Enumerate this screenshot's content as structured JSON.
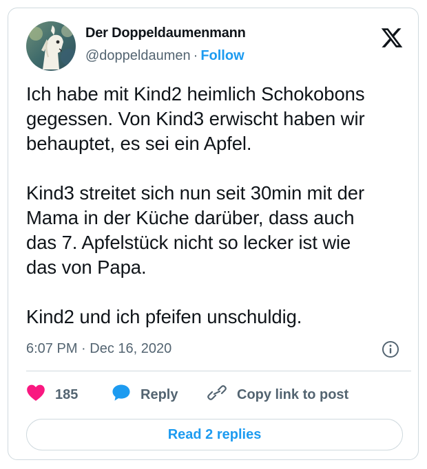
{
  "author": {
    "name": "Der Doppeldaumenmann",
    "handle": "@doppeldaumen",
    "separator": "·",
    "follow_label": "Follow",
    "avatar_icon": "avatar-image",
    "platform_icon": "x-logo-icon"
  },
  "tweet": {
    "text": "Ich habe mit Kind2 heimlich Schokobons\ngegessen. Von Kind3 erwischt haben wir\nbehauptet, es sei ein Apfel.\n\nKind3 streitet sich nun seit 30min mit der\nMama in der Küche darüber, dass auch\ndas 7. Apfelstück nicht so lecker ist wie\ndas von Papa.\n\nKind2 und ich pfeifen unschuldig.",
    "timestamp": "6:07 PM · Dec 16, 2020",
    "info_icon": "info-icon"
  },
  "actions": {
    "like_count": "185",
    "like_icon": "heart-icon",
    "like_color": "#f91880",
    "reply_label": "Reply",
    "reply_icon": "reply-bubble-icon",
    "reply_color": "#1d9bf0",
    "copy_link_label": "Copy link to post",
    "copy_link_icon": "link-icon"
  },
  "footer": {
    "read_replies_label": "Read 2 replies"
  },
  "colors": {
    "accent": "#1d9bf0",
    "text": "#0f1419",
    "secondary_text": "#536471",
    "border": "#cfd9de"
  }
}
